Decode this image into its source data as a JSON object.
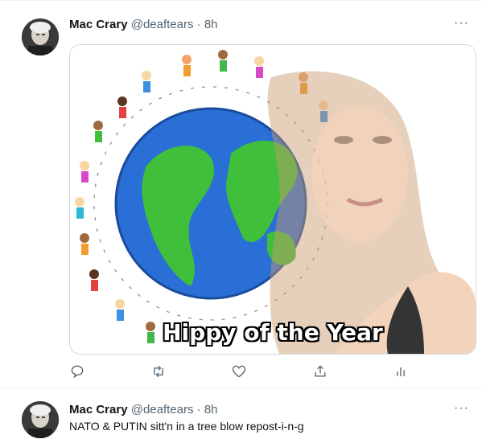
{
  "tweets": [
    {
      "name": "Mac Crary",
      "handle": "@deaftears",
      "separator": "·",
      "time": "8h",
      "more_label": "···",
      "media": {
        "caption": "Hippy of the Year"
      },
      "actions": [
        "reply-icon",
        "retweet-icon",
        "like-icon",
        "share-icon",
        "analytics-icon"
      ]
    },
    {
      "name": "Mac Crary",
      "handle": "@deaftears",
      "separator": "·",
      "time": "8h",
      "more_label": "···",
      "text": "NATO & PUTIN sitt'n in a tree blow repost-i-n-g"
    }
  ],
  "colors": {
    "text": "#0f1419",
    "secondary": "#536471",
    "border": "#eff3f4"
  }
}
